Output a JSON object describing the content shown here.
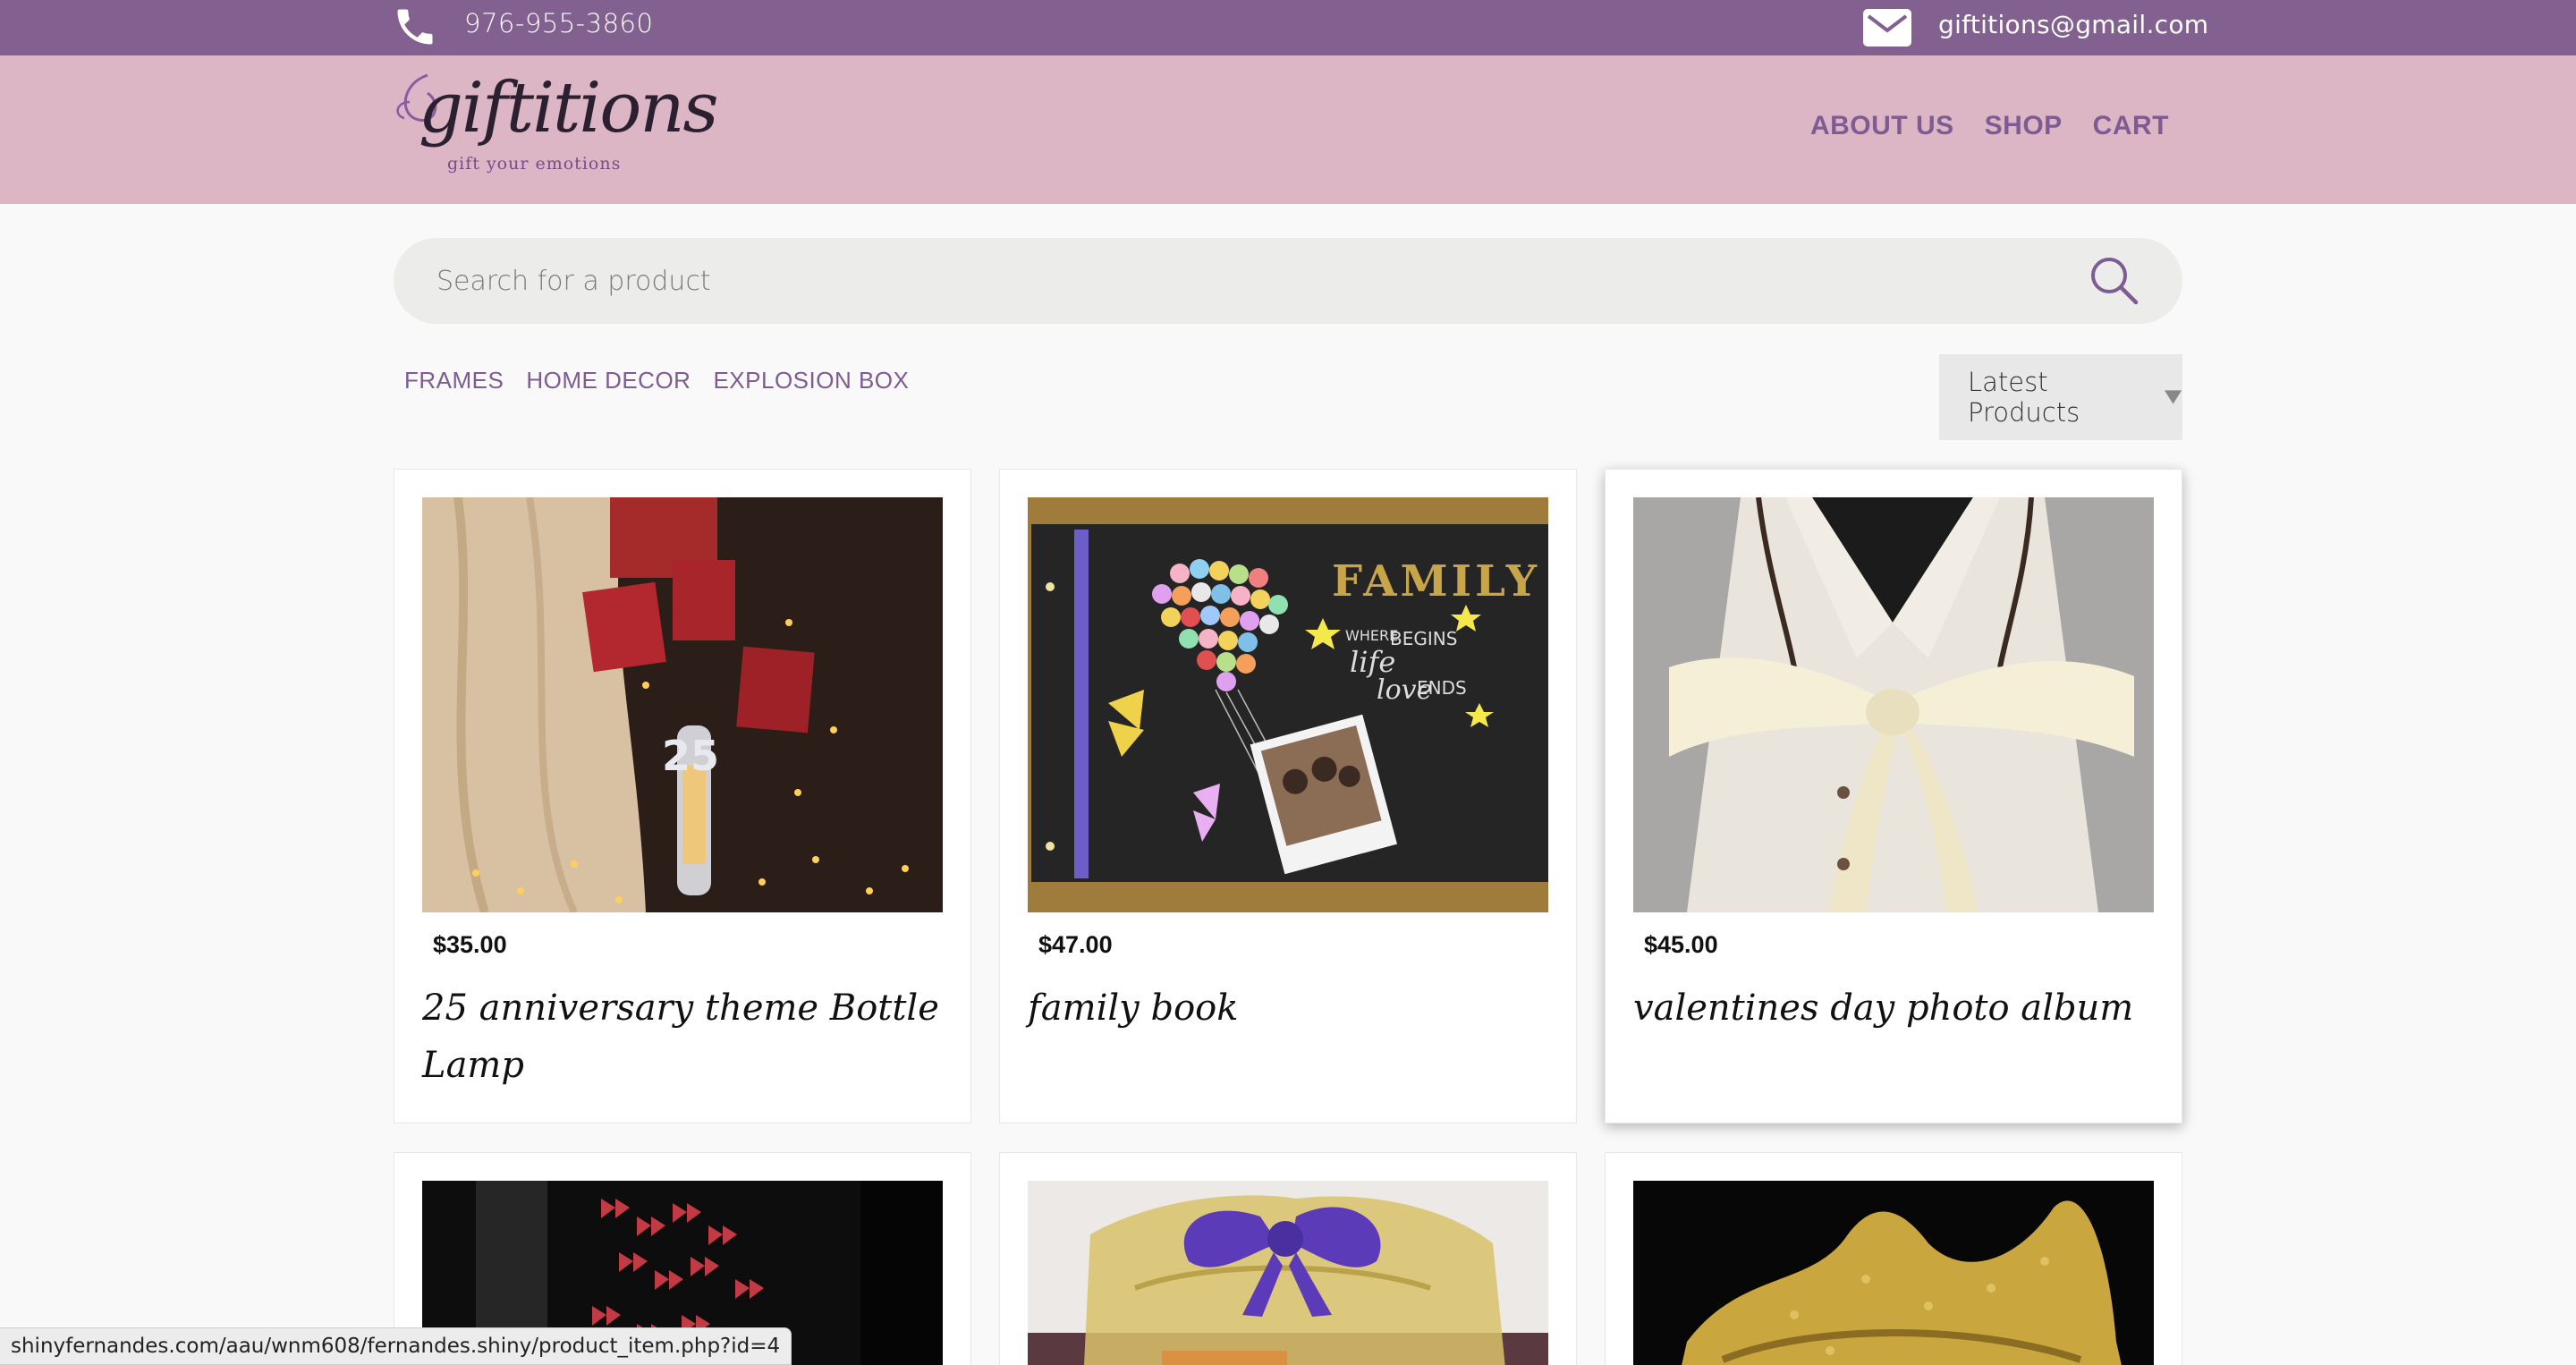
{
  "topbar": {
    "phone": "976-955-3860",
    "email": "giftitions@gmail.com"
  },
  "logo": {
    "word": "giftitions",
    "tagline": "gift your emotions"
  },
  "nav": {
    "items": [
      "ABOUT US",
      "SHOP",
      "CART"
    ]
  },
  "search": {
    "placeholder": "Search for a product"
  },
  "categories": [
    "FRAMES",
    "HOME DECOR",
    "EXPLOSION BOX"
  ],
  "sort": {
    "selected": "Latest Products"
  },
  "products": [
    {
      "price": "$35.00",
      "name": "25 anniversary theme Bottle Lamp"
    },
    {
      "price": "$47.00",
      "name": "family book"
    },
    {
      "price": "$45.00",
      "name": "valentines day photo album"
    }
  ],
  "status_url": "shinyfernandes.com/aau/wnm608/fernandes.shiny/product_item.php?id=4",
  "colors": {
    "topbar": "#826090",
    "header": "#dcb6c5",
    "accent": "#7e5b92"
  }
}
